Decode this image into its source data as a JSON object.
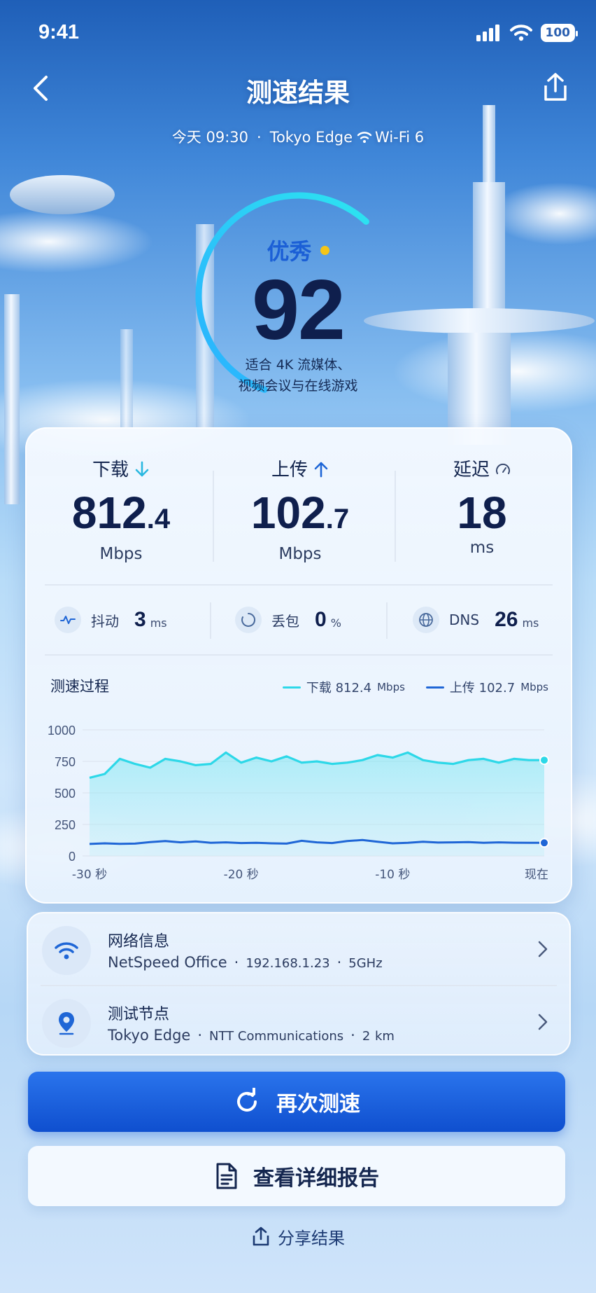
{
  "status_bar": {
    "time": "9:41",
    "battery": "100"
  },
  "nav": {
    "title": "测速结果"
  },
  "meta": {
    "date": "今天 09:30",
    "server": "Tokyo Edge",
    "network": "Wi-Fi 6",
    "sep": "·"
  },
  "score": {
    "label": "优秀",
    "value": "92",
    "desc_line1": "适合 4K 流媒体、",
    "desc_line2": "视频会议与在线游戏",
    "fraction": 0.92
  },
  "metrics": {
    "download": {
      "label": "下载",
      "int": "812",
      "dec": ".4",
      "unit": "Mbps"
    },
    "upload": {
      "label": "上传",
      "int": "102",
      "dec": ".7",
      "unit": "Mbps"
    },
    "latency": {
      "label": "延迟",
      "value": "18",
      "unit": "ms"
    }
  },
  "stats": {
    "jitter": {
      "label": "抖动",
      "value": "3",
      "unit": "ms"
    },
    "loss": {
      "label": "丢包",
      "value": "0",
      "unit": "%"
    },
    "dns": {
      "label": "DNS",
      "value": "26",
      "unit": "ms"
    }
  },
  "chart_title": "测速过程",
  "legend": {
    "download": {
      "label": "下载 812.4",
      "unit": "Mbps"
    },
    "upload": {
      "label": "上传 102.7",
      "unit": "Mbps"
    }
  },
  "chart_data": {
    "type": "area",
    "x_tick_labels": [
      "-30 秒",
      "-20 秒",
      "-10 秒",
      "现在"
    ],
    "y_tick_labels": [
      "1000",
      "750",
      "500",
      "250",
      "0"
    ],
    "ylim": [
      0,
      1000
    ],
    "x": [
      -30,
      -29,
      -28,
      -27,
      -26,
      -25,
      -24,
      -23,
      -22,
      -21,
      -20,
      -19,
      -18,
      -17,
      -16,
      -15,
      -14,
      -13,
      -12,
      -11,
      -10,
      -9,
      -8,
      -7,
      -6,
      -5,
      -4,
      -3,
      -2,
      -1,
      0
    ],
    "series": [
      {
        "name": "下载 812.4",
        "color": "#2dd8e8",
        "values": [
          620,
          650,
          770,
          730,
          700,
          770,
          750,
          720,
          730,
          820,
          740,
          780,
          750,
          790,
          740,
          750,
          730,
          740,
          760,
          800,
          780,
          820,
          760,
          740,
          730,
          760,
          770,
          740,
          770,
          760,
          760
        ]
      },
      {
        "name": "上传 102.7",
        "color": "#1f66d6",
        "values": [
          95,
          100,
          96,
          98,
          110,
          118,
          108,
          115,
          104,
          108,
          102,
          104,
          100,
          98,
          120,
          108,
          102,
          118,
          126,
          112,
          100,
          104,
          112,
          106,
          108,
          110,
          104,
          108,
          105,
          104,
          104
        ]
      }
    ]
  },
  "network_info": {
    "title": "网络信息",
    "ssid": "NetSpeed Office",
    "ip": "192.168.1.23",
    "band": "5GHz"
  },
  "test_node": {
    "title": "测试节点",
    "name": "Tokyo Edge",
    "provider": "NTT Communications",
    "distance": "2",
    "distance_unit": "km"
  },
  "buttons": {
    "retest": "再次测速",
    "report": "查看详细报告",
    "share": "分享结果"
  },
  "colors": {
    "primary": "#1557d8",
    "accent_cyan": "#2dd8e8",
    "download": "#2dd8e8",
    "upload": "#1f66d6",
    "score_dot": "#f5c518"
  }
}
